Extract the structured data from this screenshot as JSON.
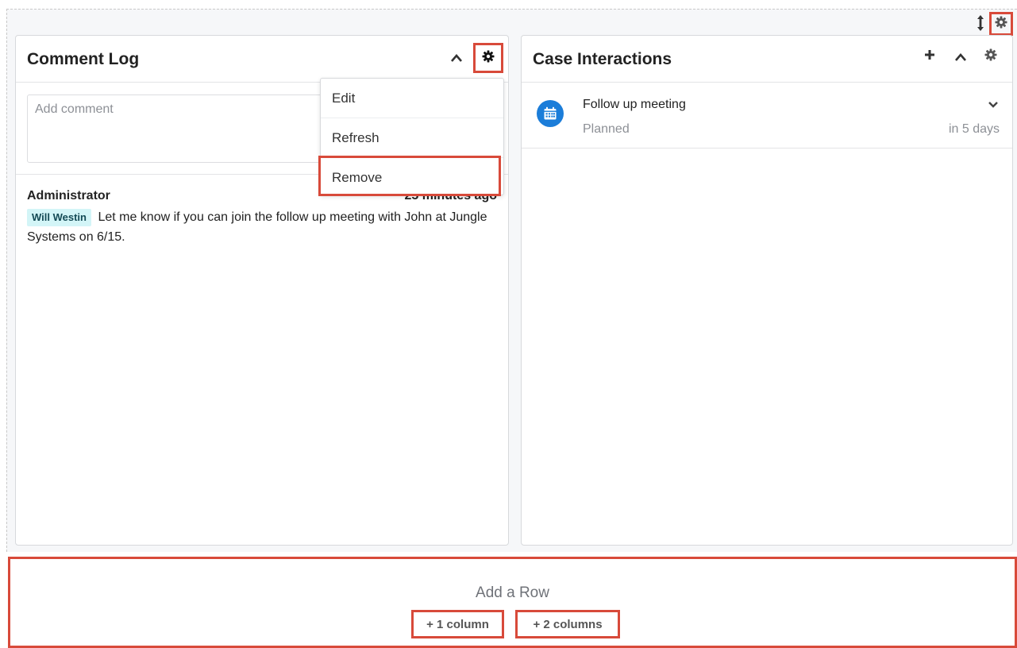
{
  "comment_log": {
    "title": "Comment Log",
    "input_placeholder": "Add comment",
    "comment": {
      "author": "Administrator",
      "time": "25 minutes ago",
      "mention": "Will Westin",
      "text": "Let me know if you can join the follow up meeting with John at Jungle Systems on 6/15."
    },
    "menu": {
      "items": [
        "Edit",
        "Refresh",
        "Remove"
      ]
    }
  },
  "case_interactions": {
    "title": "Case Interactions",
    "items": [
      {
        "name": "Follow up meeting",
        "status": "Planned",
        "due": "in 5 days",
        "icon": "calendar-icon"
      }
    ]
  },
  "add_row": {
    "title": "Add a Row",
    "one_column": "+ 1 column",
    "two_columns": "+ 2 columns"
  },
  "colors": {
    "highlight": "#d84a3a",
    "accent_blue": "#1b7dd9",
    "mention_bg": "#d3f5f7"
  }
}
